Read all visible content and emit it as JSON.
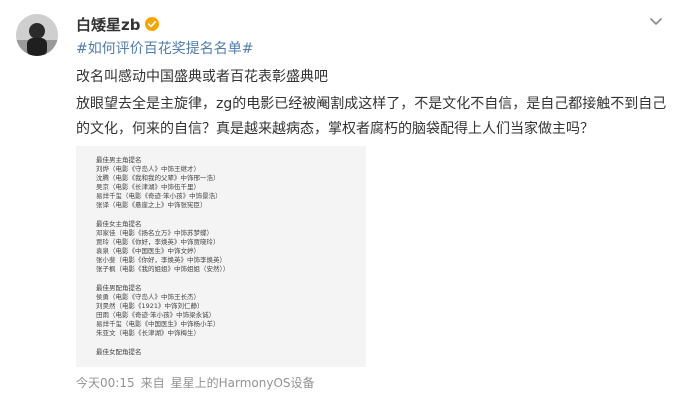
{
  "post": {
    "username": "白矮星zb",
    "topic": "#如何评价百花奖提名名单#",
    "lines": [
      "改名叫感动中国盛典或者百花表彰盛典吧",
      "放眼望去全是主旋律，zg的电影已经被阉割成这样了，不是文化不自信，是自己都接触不到自己",
      "的文化，何来的自信？真是越来越病态，掌权者腐朽的脑袋配得上人们当家做主吗？"
    ],
    "time": "今天00:15",
    "source_prefix": "来自",
    "device": "星星上的HarmonyOS设备"
  },
  "image": {
    "groups": [
      {
        "heading": "最佳男主角提名",
        "items": [
          "刘烨（电影《守岛人》中饰王继才）",
          "沈腾（电影《我和我的父辈》中饰邢一浩）",
          "吴京（电影《长津湖》中饰伍千里）",
          "易烊千玺（电影《奇迹·笨小孩》中饰景浩）",
          "张译（电影《悬崖之上》中饰张宪臣）"
        ]
      },
      {
        "heading": "最佳女主角提名",
        "items": [
          "邓家佳（电影《扬名立万》中饰苏梦蝶）",
          "贾玲（电影《你好，李焕英》中饰贾晓玲）",
          "袁泉（电影《中国医生》中饰文婷）",
          "张小斐（电影《你好，李焕英》中饰李焕英）",
          "张子枫（电影《我的姐姐》中饰姐姐（安然））"
        ]
      },
      {
        "heading": "最佳男配角提名",
        "items": [
          "侯勇（电影《守岛人》中饰王长杰）",
          "刘昊然（电影《1921》中饰刘仁静）",
          "田雨（电影《奇迹·笨小孩》中饰梁永诚）",
          "易烊千玺（电影《中国医生》中饰杨小羊）",
          "朱亚文（电影《长津湖》中饰梅生）"
        ]
      },
      {
        "heading": "最佳女配角提名",
        "items": []
      }
    ]
  },
  "colors": {
    "link": "#507daf",
    "text": "#333333",
    "meta": "#939393",
    "badge": "#f8a500"
  },
  "icons": {
    "badge": "verified-badge-icon",
    "more": "chevron-down-icon"
  }
}
